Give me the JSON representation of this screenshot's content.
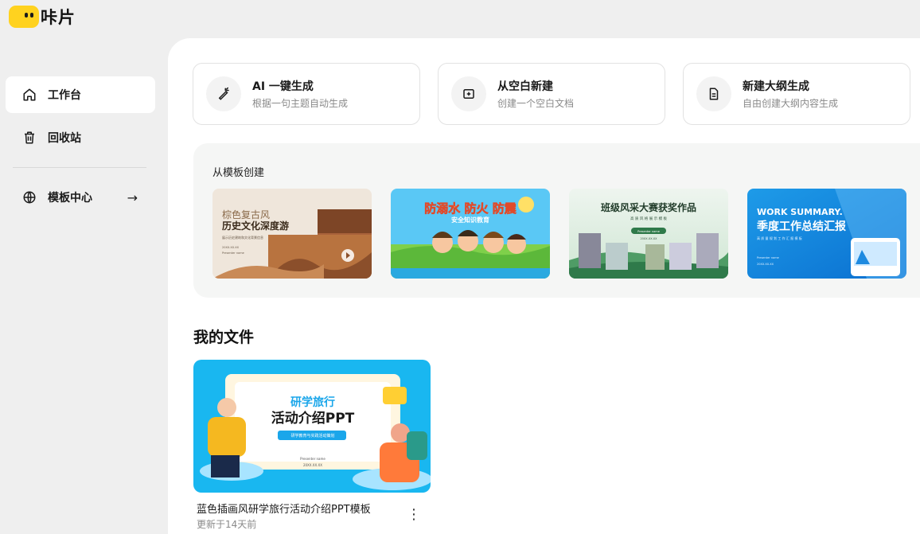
{
  "app": {
    "logo_text": "咔片"
  },
  "sidebar": {
    "items": [
      {
        "label": "工作台",
        "icon": "home-icon"
      },
      {
        "label": "回收站",
        "icon": "trash-icon"
      },
      {
        "label": "模板中心",
        "icon": "globe-icon"
      }
    ],
    "template_center_arrow": "→"
  },
  "actions": [
    {
      "title": "AI 一键生成",
      "subtitle": "根据一句主题自动生成",
      "icon": "magic-wand-icon"
    },
    {
      "title": "从空白新建",
      "subtitle": "创建一个空白文档",
      "icon": "plus-square-icon"
    },
    {
      "title": "新建大纲生成",
      "subtitle": "自由创建大纲内容生成",
      "icon": "document-icon"
    }
  ],
  "templates": {
    "section_title": "从模板创建",
    "items": [
      {
        "line1": "棕色复古风",
        "line2": "历史文化深度游",
        "line3": "展示历史建筑和文化背景信息",
        "date": "20XX.XX.XX",
        "presenter": "Presenter name"
      },
      {
        "line1": "防溺水 防火 防震",
        "line2": "安全知识教育"
      },
      {
        "line1": "班级风采大赛获奖作品",
        "line2": "高 质 风 格 展 示 模 板",
        "button": "Presenter name",
        "date": "20XX.XX.XX"
      },
      {
        "line1": "WORK SUMMARY.",
        "line2": "季度工作总结汇报",
        "line3": "高 质 量 规 划 工 作 汇 报 模 板",
        "presenter": "Presenter name",
        "date": "20XX.XX.XX"
      }
    ]
  },
  "files": {
    "section_title": "我的文件",
    "items": [
      {
        "name": "蓝色插画风研学旅行活动介绍PPT模板",
        "updated": "更新于14天前",
        "thumb_line1": "研学旅行",
        "thumb_line2": "活动介绍PPT",
        "thumb_tag": "研学教育与实践活动策划",
        "thumb_presenter": "Presenter name",
        "thumb_date": "20XX.XX.XX",
        "more": "⋮"
      }
    ]
  },
  "colors": {
    "brand_yellow": "#ffd21f",
    "canvas": "#efefef",
    "panel": "#ffffff"
  }
}
